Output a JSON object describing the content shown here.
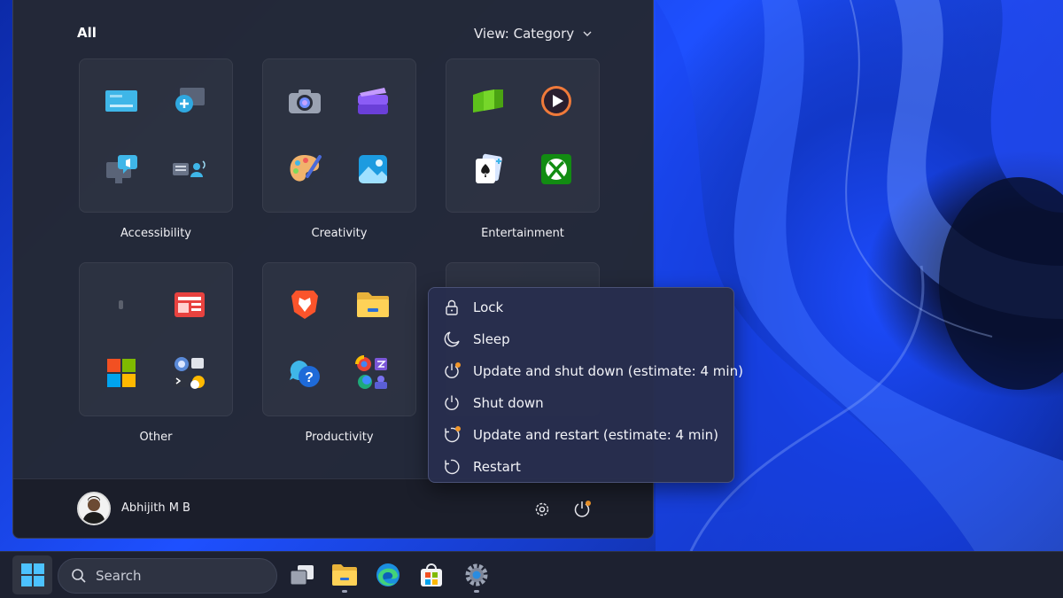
{
  "start_menu": {
    "all_label": "All",
    "view_label": "View: Category",
    "categories": [
      {
        "label": "Accessibility",
        "icons": [
          "narrator-icon",
          "magnifier-icon",
          "live-captions-icon",
          "voice-access-icon"
        ]
      },
      {
        "label": "Creativity",
        "icons": [
          "camera-icon",
          "clipchamp-icon",
          "paint-icon",
          "photos-icon"
        ]
      },
      {
        "label": "Entertainment",
        "icons": [
          "nvidia-icon",
          "media-player-icon",
          "solitaire-icon",
          "xbox-icon"
        ]
      },
      {
        "label": "Other",
        "icons": [
          "blank-app-icon",
          "news-icon",
          "microsoft-store-tiles-icon",
          "utilities-icon"
        ]
      },
      {
        "label": "Productivity",
        "icons": [
          "brave-icon",
          "file-explorer-icon",
          "get-help-icon",
          "app-folder-icon"
        ]
      }
    ],
    "user": {
      "name": "Abhijith M B"
    }
  },
  "power_menu": {
    "items": [
      {
        "label": "Lock",
        "icon": "lock-icon"
      },
      {
        "label": "Sleep",
        "icon": "sleep-icon"
      },
      {
        "label": "Update and shut down (estimate: 4 min)",
        "icon": "update-shutdown-icon"
      },
      {
        "label": "Shut down",
        "icon": "power-icon"
      },
      {
        "label": "Update and restart (estimate: 4 min)",
        "icon": "update-restart-icon"
      },
      {
        "label": "Restart",
        "icon": "restart-icon"
      }
    ]
  },
  "taskbar": {
    "search_placeholder": "Search",
    "apps": [
      "task-view-icon",
      "file-explorer-icon",
      "edge-icon",
      "store-icon",
      "settings-icon"
    ]
  },
  "colors": {
    "accent": "#f0962a",
    "wallpaper_blue": "#1e50ff",
    "panel": "#242834"
  }
}
